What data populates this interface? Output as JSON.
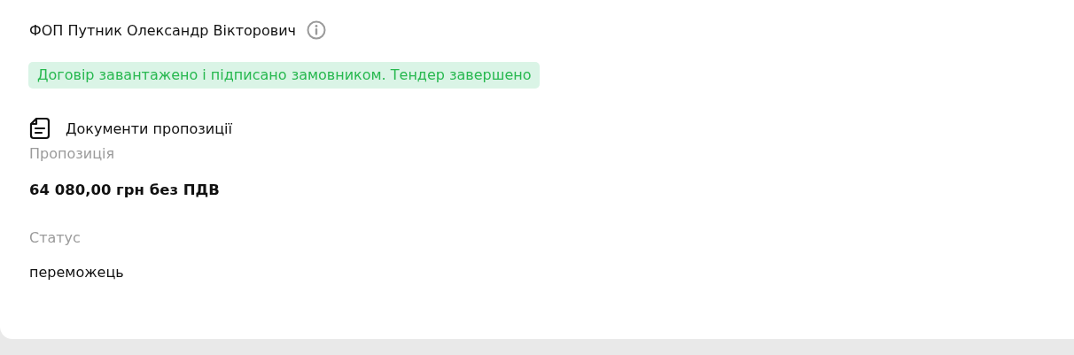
{
  "supplier": {
    "name": "ФОП Путник Олександр Вікторович"
  },
  "status_message": {
    "text": "Договір завантажено і підписано замовником. Тендер завершено",
    "kind": "success"
  },
  "documents_link": {
    "label": "Документи пропозиції"
  },
  "fields": [
    {
      "label": "Пропозиція",
      "value": "64 080,00 грн без ПДВ",
      "kind": "amount"
    },
    {
      "label": "Статус",
      "value": "переможець",
      "kind": "text"
    }
  ]
}
